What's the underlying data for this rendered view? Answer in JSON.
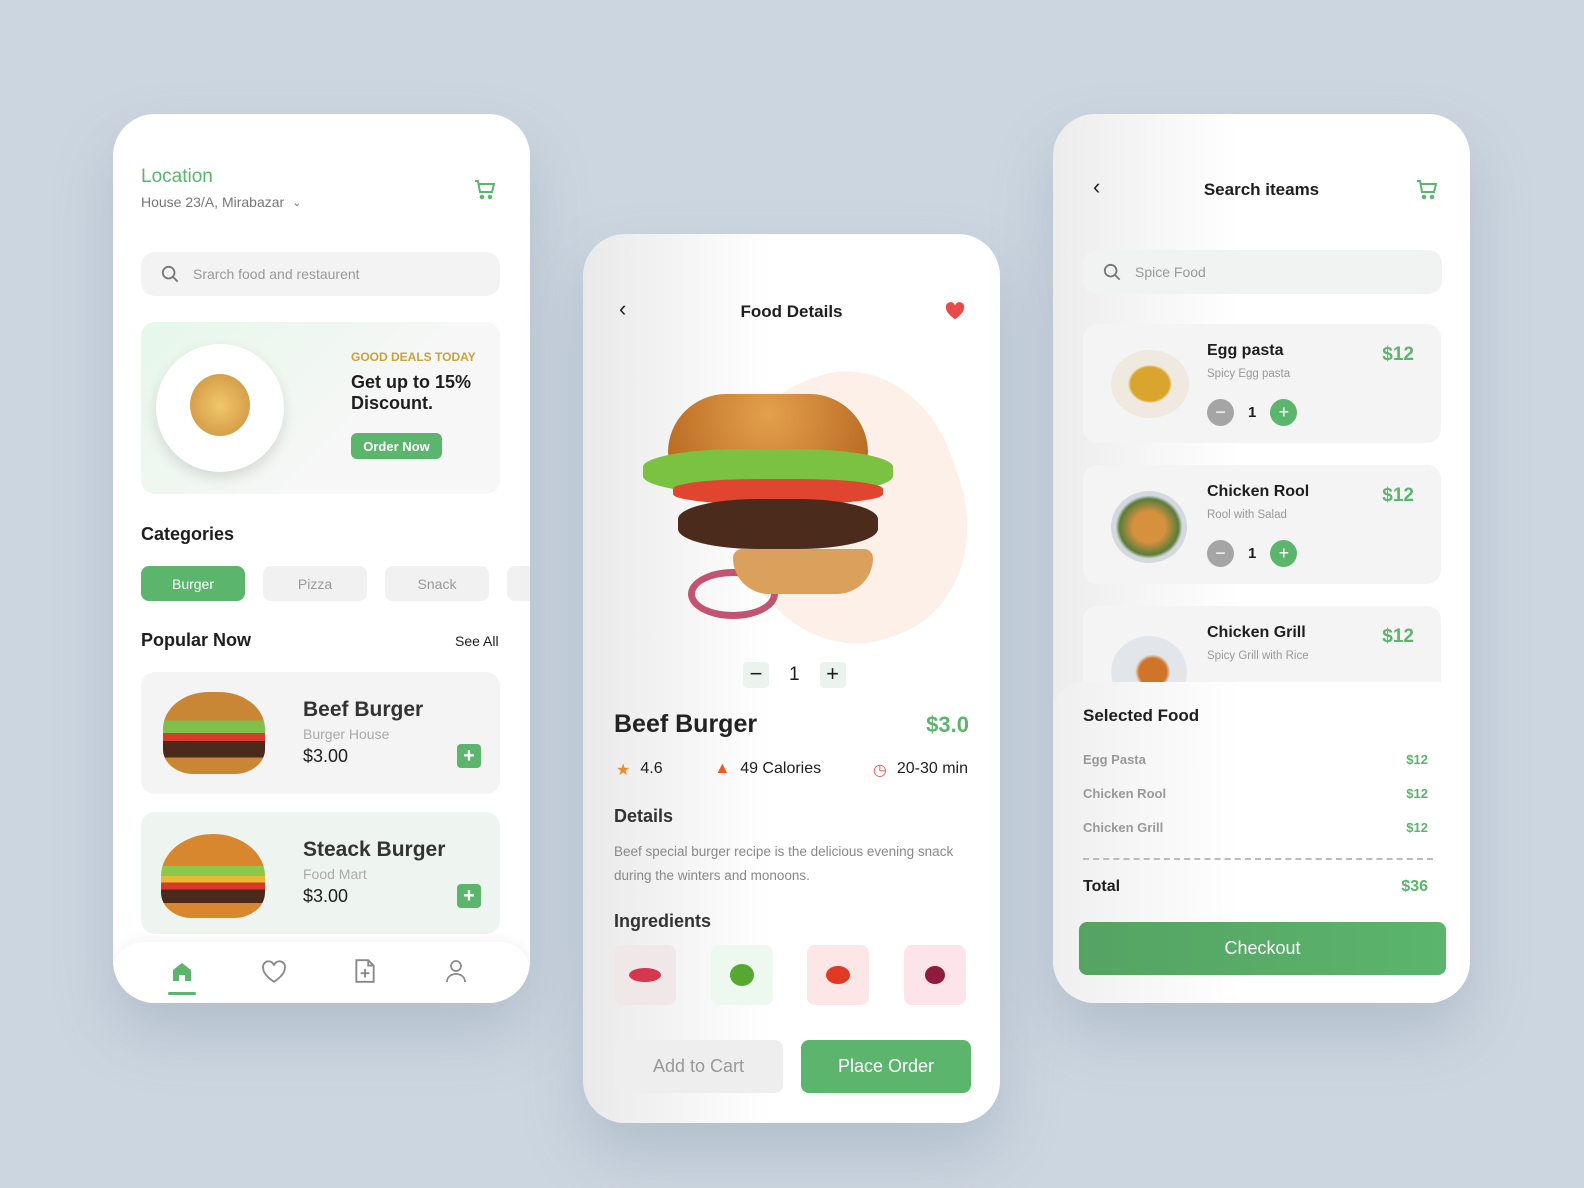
{
  "colors": {
    "accent": "#5bb56c",
    "deal": "#c9a23c",
    "background": "#ccd6e0"
  },
  "home": {
    "location_label": "Location",
    "address": "House 23/A, Mirabazar",
    "search_placeholder": "Srarch food and restaurent",
    "promo": {
      "tag": "GOOD DEALS TODAY",
      "headline": "Get up to 15% Discount.",
      "button": "Order Now"
    },
    "categories_title": "Categories",
    "categories": [
      {
        "label": "Burger",
        "active": true
      },
      {
        "label": "Pizza",
        "active": false
      },
      {
        "label": "Snack",
        "active": false
      }
    ],
    "popular_title": "Popular Now",
    "see_all": "See All",
    "popular": [
      {
        "name": "Beef Burger",
        "shop": "Burger House",
        "price": "$3.00"
      },
      {
        "name": "Steack Burger",
        "shop": "Food Mart",
        "price": "$3.00"
      }
    ],
    "nav": [
      "home-icon",
      "heart-icon",
      "document-add-icon",
      "user-icon"
    ]
  },
  "details": {
    "title": "Food Details",
    "quantity": "1",
    "name": "Beef Burger",
    "price": "$3.0",
    "rating": "4.6",
    "calories": "49 Calories",
    "time": "20-30 min",
    "details_title": "Details",
    "description": "Beef special burger recipe is the delicious evening snack during the winters and monoons.",
    "ingredients_title": "Ingredients",
    "ingredients": [
      "meat",
      "lettuce",
      "tomato",
      "onion"
    ],
    "add_to_cart": "Add to Cart",
    "place_order": "Place Order"
  },
  "search": {
    "title": "Search iteams",
    "search_value": "Spice Food",
    "items": [
      {
        "name": "Egg pasta",
        "desc": "Spicy Egg pasta",
        "price": "$12",
        "qty": "1"
      },
      {
        "name": "Chicken Rool",
        "desc": "Rool with Salad",
        "price": "$12",
        "qty": "1"
      },
      {
        "name": "Chicken Grill",
        "desc": "Spicy Grill with Rice",
        "price": "$12"
      }
    ],
    "selected_title": "Selected Food",
    "selected": [
      {
        "name": "Egg Pasta",
        "price": "$12"
      },
      {
        "name": "Chicken Rool",
        "price": "$12"
      },
      {
        "name": "Chicken Grill",
        "price": "$12"
      }
    ],
    "total_label": "Total",
    "total": "$36",
    "checkout": "Checkout"
  }
}
